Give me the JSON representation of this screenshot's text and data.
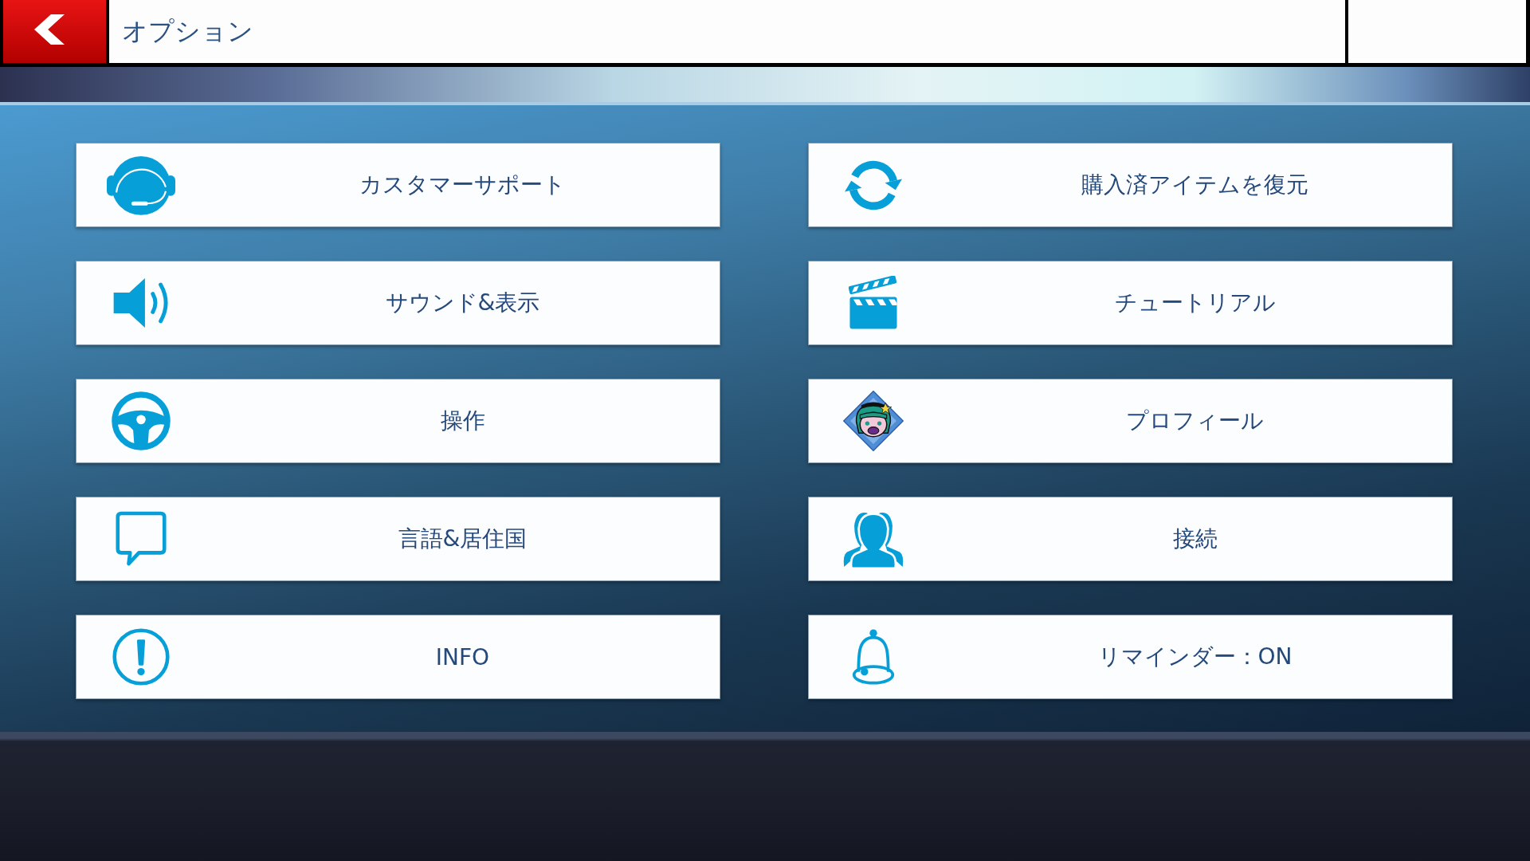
{
  "header": {
    "title": "オプション"
  },
  "menu": {
    "items": [
      {
        "label": "カスタマーサポート"
      },
      {
        "label": "購入済アイテムを復元"
      },
      {
        "label": "サウンド&表示"
      },
      {
        "label": "チュートリアル"
      },
      {
        "label": "操作"
      },
      {
        "label": "プロフィール"
      },
      {
        "label": "言語&居住国"
      },
      {
        "label": "接続"
      },
      {
        "label": "INFO"
      },
      {
        "label": "リマインダー：ON"
      }
    ]
  }
}
